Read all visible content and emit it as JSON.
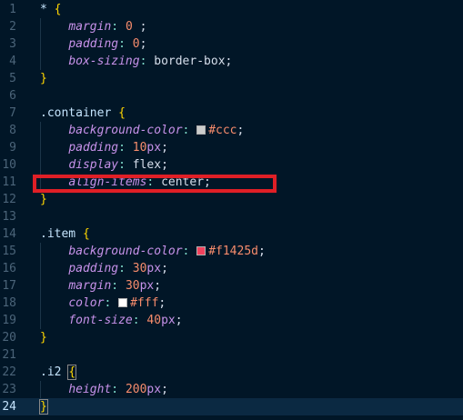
{
  "editor": {
    "lines": [
      {
        "n": "1",
        "tokens": [
          {
            "t": "* ",
            "c": "sel"
          },
          {
            "t": "{",
            "c": "brace"
          }
        ]
      },
      {
        "n": "2",
        "tokens": [
          {
            "t": "    "
          },
          {
            "t": "margin",
            "c": "prop"
          },
          {
            "t": ": ",
            "c": "colon"
          },
          {
            "t": "0",
            "c": "num"
          },
          {
            "t": " ;",
            "c": "punct"
          }
        ]
      },
      {
        "n": "3",
        "tokens": [
          {
            "t": "    "
          },
          {
            "t": "padding",
            "c": "prop"
          },
          {
            "t": ": ",
            "c": "colon"
          },
          {
            "t": "0",
            "c": "num"
          },
          {
            "t": ";",
            "c": "punct"
          }
        ]
      },
      {
        "n": "4",
        "tokens": [
          {
            "t": "    "
          },
          {
            "t": "box-sizing",
            "c": "prop"
          },
          {
            "t": ": ",
            "c": "colon"
          },
          {
            "t": "border-box",
            "c": "val"
          },
          {
            "t": ";",
            "c": "punct"
          }
        ]
      },
      {
        "n": "5",
        "tokens": [
          {
            "t": "}",
            "c": "brace"
          }
        ]
      },
      {
        "n": "6",
        "tokens": []
      },
      {
        "n": "7",
        "tokens": [
          {
            "t": ".container ",
            "c": "sel"
          },
          {
            "t": "{",
            "c": "brace"
          }
        ]
      },
      {
        "n": "8",
        "tokens": [
          {
            "t": "    "
          },
          {
            "t": "background-color",
            "c": "prop"
          },
          {
            "t": ": ",
            "c": "colon"
          },
          {
            "swatch": "#cccccc"
          },
          {
            "t": "#ccc",
            "c": "num"
          },
          {
            "t": ";",
            "c": "punct"
          }
        ]
      },
      {
        "n": "9",
        "tokens": [
          {
            "t": "    "
          },
          {
            "t": "padding",
            "c": "prop"
          },
          {
            "t": ": ",
            "c": "colon"
          },
          {
            "t": "10",
            "c": "num"
          },
          {
            "t": "px",
            "c": "unit"
          },
          {
            "t": ";",
            "c": "punct"
          }
        ]
      },
      {
        "n": "10",
        "tokens": [
          {
            "t": "    "
          },
          {
            "t": "display",
            "c": "prop"
          },
          {
            "t": ": ",
            "c": "colon"
          },
          {
            "t": "flex",
            "c": "val"
          },
          {
            "t": ";",
            "c": "punct"
          }
        ]
      },
      {
        "n": "11",
        "tokens": [
          {
            "t": "    "
          },
          {
            "t": "align-items",
            "c": "prop"
          },
          {
            "t": ": ",
            "c": "colon"
          },
          {
            "t": "center",
            "c": "val"
          },
          {
            "t": ";",
            "c": "punct"
          }
        ]
      },
      {
        "n": "12",
        "tokens": [
          {
            "t": "}",
            "c": "brace"
          }
        ]
      },
      {
        "n": "13",
        "tokens": []
      },
      {
        "n": "14",
        "tokens": [
          {
            "t": ".item ",
            "c": "sel"
          },
          {
            "t": "{",
            "c": "brace"
          }
        ]
      },
      {
        "n": "15",
        "tokens": [
          {
            "t": "    "
          },
          {
            "t": "background-color",
            "c": "prop"
          },
          {
            "t": ": ",
            "c": "colon"
          },
          {
            "swatch": "#f1425d"
          },
          {
            "t": "#f1425d",
            "c": "num"
          },
          {
            "t": ";",
            "c": "punct"
          }
        ]
      },
      {
        "n": "16",
        "tokens": [
          {
            "t": "    "
          },
          {
            "t": "padding",
            "c": "prop"
          },
          {
            "t": ": ",
            "c": "colon"
          },
          {
            "t": "30",
            "c": "num"
          },
          {
            "t": "px",
            "c": "unit"
          },
          {
            "t": ";",
            "c": "punct"
          }
        ]
      },
      {
        "n": "17",
        "tokens": [
          {
            "t": "    "
          },
          {
            "t": "margin",
            "c": "prop"
          },
          {
            "t": ": ",
            "c": "colon"
          },
          {
            "t": "30",
            "c": "num"
          },
          {
            "t": "px",
            "c": "unit"
          },
          {
            "t": ";",
            "c": "punct"
          }
        ]
      },
      {
        "n": "18",
        "tokens": [
          {
            "t": "    "
          },
          {
            "t": "color",
            "c": "prop"
          },
          {
            "t": ": ",
            "c": "colon"
          },
          {
            "swatch": "#ffffff"
          },
          {
            "t": "#fff",
            "c": "num"
          },
          {
            "t": ";",
            "c": "punct"
          }
        ]
      },
      {
        "n": "19",
        "tokens": [
          {
            "t": "    "
          },
          {
            "t": "font-size",
            "c": "prop"
          },
          {
            "t": ": ",
            "c": "colon"
          },
          {
            "t": "40",
            "c": "num"
          },
          {
            "t": "px",
            "c": "unit"
          },
          {
            "t": ";",
            "c": "punct"
          }
        ]
      },
      {
        "n": "20",
        "tokens": [
          {
            "t": "}",
            "c": "brace"
          }
        ]
      },
      {
        "n": "21",
        "tokens": []
      },
      {
        "n": "22",
        "tokens": [
          {
            "t": ".i2 ",
            "c": "sel"
          },
          {
            "t": "{",
            "c": "brace",
            "match": true
          }
        ]
      },
      {
        "n": "23",
        "tokens": [
          {
            "t": "    "
          },
          {
            "t": "height",
            "c": "prop"
          },
          {
            "t": ": ",
            "c": "colon"
          },
          {
            "t": "200",
            "c": "num"
          },
          {
            "t": "px",
            "c": "unit"
          },
          {
            "t": ";",
            "c": "punct"
          }
        ]
      },
      {
        "n": "24",
        "tokens": [
          {
            "t": "}",
            "c": "brace",
            "match": true
          }
        ],
        "active": true
      }
    ],
    "highlight_line": "11",
    "highlight_color": "#e01f26",
    "background_color": "#011627"
  }
}
